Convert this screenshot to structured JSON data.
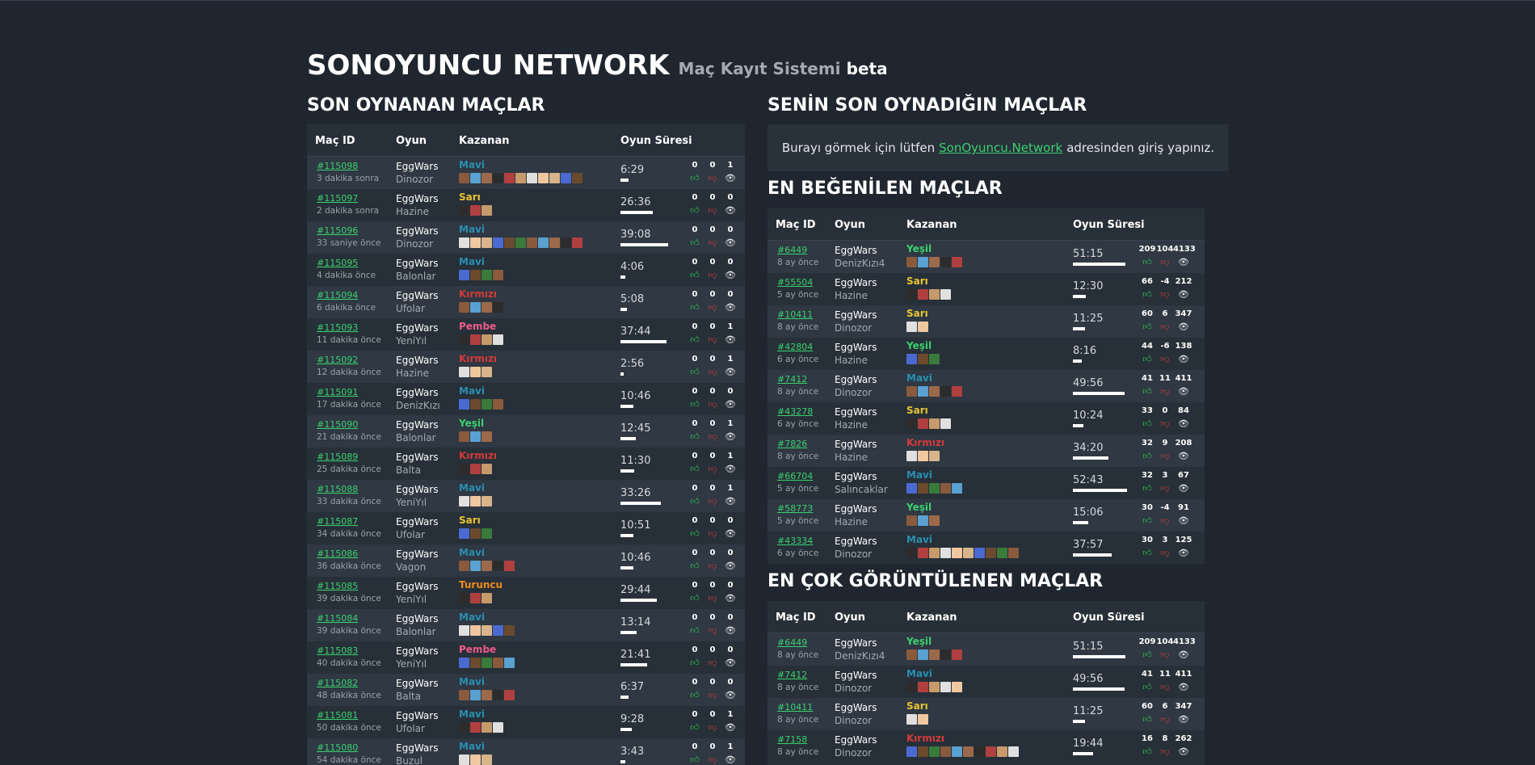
{
  "header": {
    "title": "SONOYUNCU NETWORK",
    "subtitle": "Maç Kayıt Sistemi",
    "badge": "beta"
  },
  "sections": {
    "recent": "SON OYNANAN MAÇLAR",
    "mine": "SENİN SON OYNADIĞIN MAÇLAR",
    "liked": "EN BEĞENİLEN MAÇLAR",
    "viewed": "EN ÇOK GÖRÜNTÜLENEN MAÇLAR"
  },
  "columns": {
    "id": "Maç ID",
    "game": "Oyun",
    "winner": "Kazanan",
    "duration": "Oyun Süresi"
  },
  "notice": {
    "before": "Burayı görmek için lütfen",
    "link": "SonOyuncu.Network",
    "after": "adresinden giriş yapınız."
  },
  "team_colors": {
    "Mavi": "#2a8fb0",
    "Sarı": "#e8c534",
    "Kırmızı": "#d33a3a",
    "Pembe": "#f05a8a",
    "Yeşil": "#3bd16f",
    "Turuncu": "#f08a1c"
  },
  "icons": {
    "like": "thumbs-up-icon",
    "dislike": "thumbs-down-icon",
    "views": "eye-icon"
  },
  "recent": [
    {
      "id": "#115098",
      "ago": "3 dakika sonra",
      "game": "EggWars",
      "map": "Dinozor",
      "team": "Mavi",
      "players": 11,
      "duration": "6:29",
      "likes": "0",
      "dislikes": "0",
      "views": "1"
    },
    {
      "id": "#115097",
      "ago": "2 dakika sonra",
      "game": "EggWars",
      "map": "Hazine",
      "team": "Sarı",
      "players": 3,
      "duration": "26:36",
      "likes": "0",
      "dislikes": "0",
      "views": "0"
    },
    {
      "id": "#115096",
      "ago": "33 saniye önce",
      "game": "EggWars",
      "map": "Dinozor",
      "team": "Mavi",
      "players": 11,
      "duration": "39:08",
      "likes": "0",
      "dislikes": "0",
      "views": "0"
    },
    {
      "id": "#115095",
      "ago": "4 dakika önce",
      "game": "EggWars",
      "map": "Balonlar",
      "team": "Mavi",
      "players": 4,
      "duration": "4:06",
      "likes": "0",
      "dislikes": "0",
      "views": "0"
    },
    {
      "id": "#115094",
      "ago": "6 dakika önce",
      "game": "EggWars",
      "map": "Ufolar",
      "team": "Kırmızı",
      "players": 4,
      "duration": "5:08",
      "likes": "0",
      "dislikes": "0",
      "views": "0"
    },
    {
      "id": "#115093",
      "ago": "11 dakika önce",
      "game": "EggWars",
      "map": "YeniYıl",
      "team": "Pembe",
      "players": 4,
      "duration": "37:44",
      "likes": "0",
      "dislikes": "0",
      "views": "1"
    },
    {
      "id": "#115092",
      "ago": "12 dakika önce",
      "game": "EggWars",
      "map": "Hazine",
      "team": "Kırmızı",
      "players": 3,
      "duration": "2:56",
      "likes": "0",
      "dislikes": "0",
      "views": "1"
    },
    {
      "id": "#115091",
      "ago": "17 dakika önce",
      "game": "EggWars",
      "map": "DenizKızı",
      "team": "Mavi",
      "players": 4,
      "duration": "10:46",
      "likes": "0",
      "dislikes": "0",
      "views": "0"
    },
    {
      "id": "#115090",
      "ago": "21 dakika önce",
      "game": "EggWars",
      "map": "Balonlar",
      "team": "Yeşil",
      "players": 3,
      "duration": "12:45",
      "likes": "0",
      "dislikes": "0",
      "views": "1"
    },
    {
      "id": "#115089",
      "ago": "25 dakika önce",
      "game": "EggWars",
      "map": "Balta",
      "team": "Kırmızı",
      "players": 3,
      "duration": "11:30",
      "likes": "0",
      "dislikes": "0",
      "views": "1"
    },
    {
      "id": "#115088",
      "ago": "33 dakika önce",
      "game": "EggWars",
      "map": "YeniYıl",
      "team": "Mavi",
      "players": 3,
      "duration": "33:26",
      "likes": "0",
      "dislikes": "0",
      "views": "1"
    },
    {
      "id": "#115087",
      "ago": "34 dakika önce",
      "game": "EggWars",
      "map": "Ufolar",
      "team": "Sarı",
      "players": 3,
      "duration": "10:51",
      "likes": "0",
      "dislikes": "0",
      "views": "0"
    },
    {
      "id": "#115086",
      "ago": "36 dakika önce",
      "game": "EggWars",
      "map": "Vagon",
      "team": "Mavi",
      "players": 5,
      "duration": "10:46",
      "likes": "0",
      "dislikes": "0",
      "views": "0"
    },
    {
      "id": "#115085",
      "ago": "39 dakika önce",
      "game": "EggWars",
      "map": "YeniYıl",
      "team": "Turuncu",
      "players": 3,
      "duration": "29:44",
      "likes": "0",
      "dislikes": "0",
      "views": "0"
    },
    {
      "id": "#115084",
      "ago": "39 dakika önce",
      "game": "EggWars",
      "map": "Balonlar",
      "team": "Mavi",
      "players": 5,
      "duration": "13:14",
      "likes": "0",
      "dislikes": "0",
      "views": "0"
    },
    {
      "id": "#115083",
      "ago": "40 dakika önce",
      "game": "EggWars",
      "map": "YeniYıl",
      "team": "Pembe",
      "players": 5,
      "duration": "21:41",
      "likes": "0",
      "dislikes": "0",
      "views": "0"
    },
    {
      "id": "#115082",
      "ago": "48 dakika önce",
      "game": "EggWars",
      "map": "Balta",
      "team": "Mavi",
      "players": 5,
      "duration": "6:37",
      "likes": "0",
      "dislikes": "0",
      "views": "0"
    },
    {
      "id": "#115081",
      "ago": "50 dakika önce",
      "game": "EggWars",
      "map": "Ufolar",
      "team": "Mavi",
      "players": 4,
      "duration": "9:28",
      "likes": "0",
      "dislikes": "0",
      "views": "1"
    },
    {
      "id": "#115080",
      "ago": "54 dakika önce",
      "game": "EggWars",
      "map": "Buzul",
      "team": "Mavi",
      "players": 3,
      "duration": "3:43",
      "likes": "0",
      "dislikes": "0",
      "views": "1"
    }
  ],
  "liked": [
    {
      "id": "#6449",
      "ago": "8 ay önce",
      "game": "EggWars",
      "map": "DenizKızı4",
      "team": "Yeşil",
      "players": 5,
      "duration": "51:15",
      "likes": "209",
      "dislikes": "104",
      "views": "4133"
    },
    {
      "id": "#55504",
      "ago": "5 ay önce",
      "game": "EggWars",
      "map": "Hazine",
      "team": "Sarı",
      "players": 4,
      "duration": "12:30",
      "likes": "66",
      "dislikes": "-4",
      "views": "212"
    },
    {
      "id": "#10411",
      "ago": "8 ay önce",
      "game": "EggWars",
      "map": "Dinozor",
      "team": "Sarı",
      "players": 2,
      "duration": "11:25",
      "likes": "60",
      "dislikes": "6",
      "views": "347"
    },
    {
      "id": "#42804",
      "ago": "6 ay önce",
      "game": "EggWars",
      "map": "Hazine",
      "team": "Yeşil",
      "players": 3,
      "duration": "8:16",
      "likes": "44",
      "dislikes": "-6",
      "views": "138"
    },
    {
      "id": "#7412",
      "ago": "8 ay önce",
      "game": "EggWars",
      "map": "Dinozor",
      "team": "Mavi",
      "players": 5,
      "duration": "49:56",
      "likes": "41",
      "dislikes": "11",
      "views": "411"
    },
    {
      "id": "#43278",
      "ago": "6 ay önce",
      "game": "EggWars",
      "map": "Hazine",
      "team": "Sarı",
      "players": 4,
      "duration": "10:24",
      "likes": "33",
      "dislikes": "0",
      "views": "84"
    },
    {
      "id": "#7826",
      "ago": "8 ay önce",
      "game": "EggWars",
      "map": "Hazine",
      "team": "Kırmızı",
      "players": 3,
      "duration": "34:20",
      "likes": "32",
      "dislikes": "9",
      "views": "208"
    },
    {
      "id": "#66704",
      "ago": "5 ay önce",
      "game": "EggWars",
      "map": "Salıncaklar",
      "team": "Mavi",
      "players": 5,
      "duration": "52:43",
      "likes": "32",
      "dislikes": "3",
      "views": "67"
    },
    {
      "id": "#58773",
      "ago": "5 ay önce",
      "game": "EggWars",
      "map": "Hazine",
      "team": "Yeşil",
      "players": 3,
      "duration": "15:06",
      "likes": "30",
      "dislikes": "-4",
      "views": "91"
    },
    {
      "id": "#43334",
      "ago": "6 ay önce",
      "game": "EggWars",
      "map": "Dinozor",
      "team": "Mavi",
      "players": 10,
      "duration": "37:57",
      "likes": "30",
      "dislikes": "3",
      "views": "125"
    }
  ],
  "viewed": [
    {
      "id": "#6449",
      "ago": "8 ay önce",
      "game": "EggWars",
      "map": "DenizKızı4",
      "team": "Yeşil",
      "players": 5,
      "duration": "51:15",
      "likes": "209",
      "dislikes": "104",
      "views": "4133"
    },
    {
      "id": "#7412",
      "ago": "8 ay önce",
      "game": "EggWars",
      "map": "Dinozor",
      "team": "Mavi",
      "players": 5,
      "duration": "49:56",
      "likes": "41",
      "dislikes": "11",
      "views": "411"
    },
    {
      "id": "#10411",
      "ago": "8 ay önce",
      "game": "EggWars",
      "map": "Dinozor",
      "team": "Sarı",
      "players": 2,
      "duration": "11:25",
      "likes": "60",
      "dislikes": "6",
      "views": "347"
    },
    {
      "id": "#7158",
      "ago": "8 ay önce",
      "game": "EggWars",
      "map": "Dinozor",
      "team": "Kırmızı",
      "players": 10,
      "duration": "19:44",
      "likes": "16",
      "dislikes": "8",
      "views": "262"
    }
  ]
}
